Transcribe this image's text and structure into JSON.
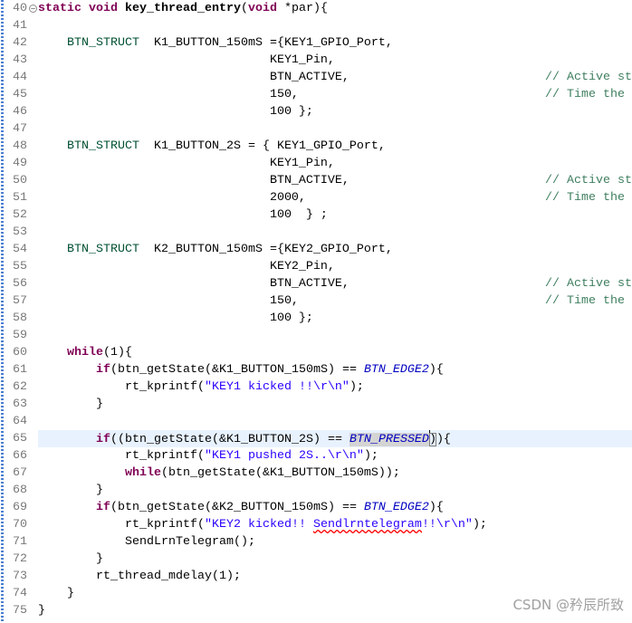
{
  "colors": {
    "background": "#FFFFFF",
    "text": "#000000",
    "line_number": "#787878",
    "current_line": "#E8F2FE",
    "ruler": "#4A7FD0",
    "fold_icon": "#8C8C8C",
    "watermark": "#A0A0A0"
  },
  "editor": {
    "lines": [
      {
        "num": "40",
        "icon": "fold-collapse-icon",
        "tokens": [
          {
            "text": "static void",
            "color": "#7F0055",
            "bold": true
          },
          {
            "text": " "
          },
          {
            "text": "key_thread_entry",
            "bold": true
          },
          {
            "text": "("
          },
          {
            "text": "void",
            "color": "#7F0055",
            "bold": true
          },
          {
            "text": " *par){"
          }
        ]
      },
      {
        "num": "41",
        "tokens": []
      },
      {
        "num": "42",
        "tokens": [
          {
            "text": "    "
          },
          {
            "text": "BTN_STRUCT",
            "color": "#005032"
          },
          {
            "text": "  K1_BUTTON_150mS ={KEY1_GPIO_Port,"
          }
        ]
      },
      {
        "num": "43",
        "tokens": [
          {
            "text": "                                KEY1_Pin,"
          }
        ]
      },
      {
        "num": "44",
        "tokens": [
          {
            "text": "                                BTN_ACTIVE,"
          },
          {
            "text": "// Active st",
            "color": "#3F7F5F",
            "trailing": true
          }
        ]
      },
      {
        "num": "45",
        "tokens": [
          {
            "text": "                                150,"
          },
          {
            "text": "// Time the",
            "color": "#3F7F5F",
            "trailing": true
          }
        ]
      },
      {
        "num": "46",
        "tokens": [
          {
            "text": "                                100 };"
          }
        ]
      },
      {
        "num": "47",
        "tokens": []
      },
      {
        "num": "48",
        "tokens": [
          {
            "text": "    "
          },
          {
            "text": "BTN_STRUCT",
            "color": "#005032"
          },
          {
            "text": "  K1_BUTTON_2S = { KEY1_GPIO_Port,"
          }
        ]
      },
      {
        "num": "49",
        "tokens": [
          {
            "text": "                                KEY1_Pin,"
          }
        ]
      },
      {
        "num": "50",
        "tokens": [
          {
            "text": "                                BTN_ACTIVE,"
          },
          {
            "text": "// Active st",
            "color": "#3F7F5F",
            "trailing": true
          }
        ]
      },
      {
        "num": "51",
        "tokens": [
          {
            "text": "                                2000,"
          },
          {
            "text": "// Time the",
            "color": "#3F7F5F",
            "trailing": true
          }
        ]
      },
      {
        "num": "52",
        "tokens": [
          {
            "text": "                                100  } ;"
          }
        ]
      },
      {
        "num": "53",
        "tokens": []
      },
      {
        "num": "54",
        "tokens": [
          {
            "text": "    "
          },
          {
            "text": "BTN_STRUCT",
            "color": "#005032"
          },
          {
            "text": "  K2_BUTTON_150mS ={KEY2_GPIO_Port,"
          }
        ]
      },
      {
        "num": "55",
        "tokens": [
          {
            "text": "                                KEY2_Pin,"
          }
        ]
      },
      {
        "num": "56",
        "tokens": [
          {
            "text": "                                BTN_ACTIVE,"
          },
          {
            "text": "// Active st",
            "color": "#3F7F5F",
            "trailing": true
          }
        ]
      },
      {
        "num": "57",
        "tokens": [
          {
            "text": "                                150,"
          },
          {
            "text": "// Time the",
            "color": "#3F7F5F",
            "trailing": true
          }
        ]
      },
      {
        "num": "58",
        "tokens": [
          {
            "text": "                                100 };"
          }
        ]
      },
      {
        "num": "59",
        "tokens": []
      },
      {
        "num": "60",
        "tokens": [
          {
            "text": "    "
          },
          {
            "text": "while",
            "color": "#7F0055",
            "bold": true
          },
          {
            "text": "(1){"
          }
        ]
      },
      {
        "num": "61",
        "tokens": [
          {
            "text": "        "
          },
          {
            "text": "if",
            "color": "#7F0055",
            "bold": true
          },
          {
            "text": "(btn_getState(&K1_BUTTON_150mS) == "
          },
          {
            "text": "BTN_EDGE2",
            "color": "#0000C0",
            "italic": true
          },
          {
            "text": "){"
          }
        ]
      },
      {
        "num": "62",
        "tokens": [
          {
            "text": "            rt_kprintf("
          },
          {
            "text": "\"KEY1 kicked !!\\r\\n\"",
            "color": "#2A00FF"
          },
          {
            "text": ");"
          }
        ]
      },
      {
        "num": "63",
        "tokens": [
          {
            "text": "        }"
          }
        ]
      },
      {
        "num": "64",
        "tokens": []
      },
      {
        "num": "65",
        "current": true,
        "tokens": [
          {
            "text": "        "
          },
          {
            "text": "if",
            "color": "#7F0055",
            "bold": true
          },
          {
            "text": "((btn_getState(&K1_BUTTON_2S) == "
          },
          {
            "text": "BTN_PRESSED",
            "color": "#0000C0",
            "italic": true,
            "highlight": "#D4D4D4"
          },
          {
            "text": ")",
            "bracket_box": "#808080",
            "cursor": true
          },
          {
            "text": "){"
          }
        ]
      },
      {
        "num": "66",
        "tokens": [
          {
            "text": "            rt_kprintf("
          },
          {
            "text": "\"KEY1 pushed 2S..\\r\\n\"",
            "color": "#2A00FF"
          },
          {
            "text": ");"
          }
        ]
      },
      {
        "num": "67",
        "tokens": [
          {
            "text": "            "
          },
          {
            "text": "while",
            "color": "#7F0055",
            "bold": true
          },
          {
            "text": "(btn_getState(&K1_BUTTON_150mS));"
          }
        ]
      },
      {
        "num": "68",
        "tokens": [
          {
            "text": "        }"
          }
        ]
      },
      {
        "num": "69",
        "tokens": [
          {
            "text": "        "
          },
          {
            "text": "if",
            "color": "#7F0055",
            "bold": true
          },
          {
            "text": "(btn_getState(&K2_BUTTON_150mS) == "
          },
          {
            "text": "BTN_EDGE2",
            "color": "#0000C0",
            "italic": true
          },
          {
            "text": "){"
          }
        ]
      },
      {
        "num": "70",
        "tokens": [
          {
            "text": "            rt_kprintf("
          },
          {
            "text": "\"KEY2 kicked!! ",
            "color": "#2A00FF"
          },
          {
            "text": "Sendlrntelegram",
            "color": "#2A00FF",
            "underline": "#FF0000"
          },
          {
            "text": "!!\\r\\n\"",
            "color": "#2A00FF"
          },
          {
            "text": ");"
          }
        ]
      },
      {
        "num": "71",
        "tokens": [
          {
            "text": "            SendLrnTelegram();"
          }
        ]
      },
      {
        "num": "72",
        "tokens": [
          {
            "text": "        }"
          }
        ]
      },
      {
        "num": "73",
        "tokens": [
          {
            "text": "        rt_thread_mdelay(1);"
          }
        ]
      },
      {
        "num": "74",
        "tokens": [
          {
            "text": "    }"
          }
        ]
      },
      {
        "num": "75",
        "tokens": [
          {
            "text": "}"
          }
        ]
      }
    ]
  },
  "watermark": "CSDN @矜辰所致"
}
